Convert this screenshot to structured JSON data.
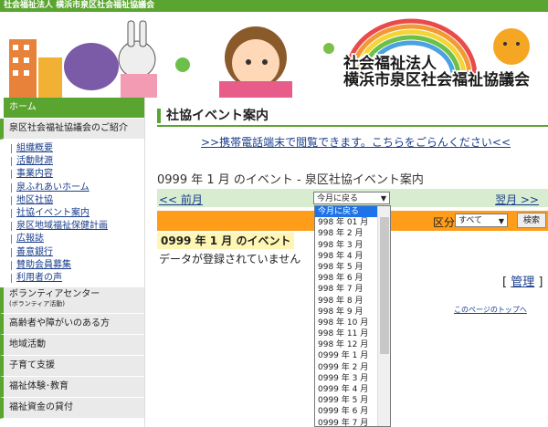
{
  "topbar": {
    "text": "社会福祉法人 横浜市泉区社会福祉協議会"
  },
  "banner": {
    "line1": "社会福祉法人",
    "line2": "横浜市泉区社会福祉協議会"
  },
  "sidebar": {
    "home": "ホーム",
    "intro": "泉区社会福祉協議会のご紹介",
    "sub": [
      "組織概要",
      "活動財源",
      "事業内容",
      "泉ふれあいホーム",
      "地区社協",
      "社協イベント案内",
      "泉区地域福祉保健計画",
      "広報誌",
      "善意銀行",
      "賛助会員募集",
      "利用者の声"
    ],
    "volunteer": "ボランティアセンター",
    "volunteer_sub": "(ボランティア活動)",
    "sections": [
      "高齢者や障がいのある方",
      "地域活動",
      "子育て支援",
      "福祉体験･教育",
      "福祉資金の貸付"
    ]
  },
  "main": {
    "title": "社協イベント案内",
    "mobile_link": ">>携帯電話端末で閲覧できます。こちらをごらんください<<",
    "month_title": "0999 年 1 月 のイベント - 泉区社協イベント案内",
    "prev": "<< 前月",
    "next": "翌月 >>",
    "month_select": "今月に戻る",
    "kubun_label": "区分:",
    "kubun_value": "すべて",
    "search_button": "検索",
    "month_heading": "0999 年 1 月 のイベント",
    "no_data": "データが登録されていません",
    "admin": "[ 管理 ]",
    "admin_link": "管理",
    "to_top": "このページのトップへ"
  },
  "dropdown": {
    "options": [
      "今月に戻る",
      "998 年 01 月",
      "998 年 2 月",
      "998 年 3 月",
      "998 年 4 月",
      "998 年 5 月",
      "998 年 6 月",
      "998 年 7 月",
      "998 年 8 月",
      "998 年 9 月",
      "998 年 10 月",
      "998 年 11 月",
      "998 年 12 月",
      "0999 年 1 月",
      "0999 年 2 月",
      "0999 年 3 月",
      "0999 年 4 月",
      "0999 年 5 月",
      "0999 年 6 月",
      "0999 年 7 月"
    ],
    "selected_index": 0
  },
  "colors": {
    "green": "#5aa530",
    "orange": "#ff9c1a",
    "link": "#1a3e8c"
  }
}
